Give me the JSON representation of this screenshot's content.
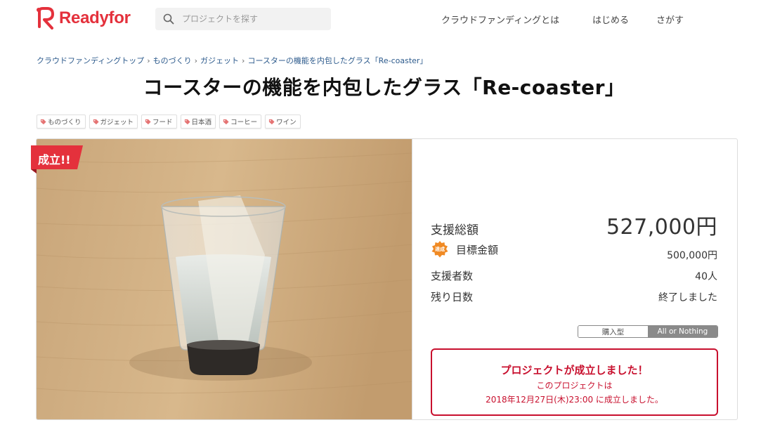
{
  "header": {
    "logo_text": "Readyfor",
    "search_placeholder": "プロジェクトを探す",
    "nav": [
      "クラウドファンディングとは",
      "はじめる",
      "さがす"
    ]
  },
  "breadcrumb": [
    "クラウドファンディングトップ",
    "ものづくり",
    "ガジェット",
    "コースターの機能を内包したグラス「Re-coaster」"
  ],
  "title": "コースターの機能を内包したグラス「Re-coaster」",
  "tags": [
    "ものづくり",
    "ガジェット",
    "フード",
    "日本酒",
    "コーヒー",
    "ワイン"
  ],
  "badge": "成立!!",
  "stats": {
    "total_label": "支援総額",
    "total_value": "527,000円",
    "goal_seal": "達成",
    "goal_label": "目標金額",
    "goal_value": "500,000円",
    "backers_label": "支援者数",
    "backers_value": "40人",
    "days_label": "残り日数",
    "days_value": "終了しました"
  },
  "project_type": {
    "options": [
      "購入型",
      "All or Nothing"
    ],
    "selected": "All or Nothing"
  },
  "success": {
    "title": "プロジェクトが成立しました！",
    "line1": "このプロジェクトは",
    "line2": "2018年12月27日(木)23:00 に成立しました。"
  },
  "colors": {
    "brand_red": "#e4313c",
    "success_red": "#c8102e",
    "link_blue": "#2c5a8c",
    "tag_icon": "#e57373",
    "seal_orange": "#f08a24"
  }
}
